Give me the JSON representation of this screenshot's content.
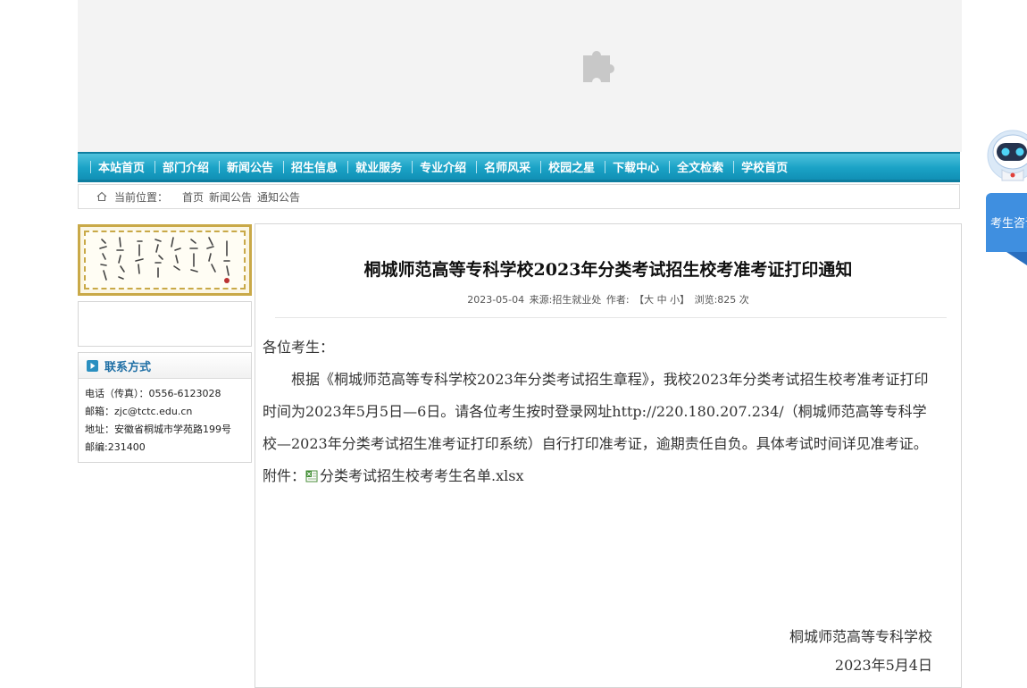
{
  "nav": {
    "items": [
      "本站首页",
      "部门介绍",
      "新闻公告",
      "招生信息",
      "就业服务",
      "专业介绍",
      "名师风采",
      "校园之星",
      "下载中心",
      "全文检索",
      "学校首页"
    ]
  },
  "breadcrumb": {
    "label": "当前位置：",
    "links": [
      "首页",
      "新闻公告",
      "通知公告"
    ]
  },
  "sidebar": {
    "contact_title": "联系方式",
    "contact_lines": [
      "电话（传真）：0556-6123028",
      "邮箱：zjc@tctc.edu.cn",
      "地址：安徽省桐城市学苑路199号",
      "邮编:231400"
    ]
  },
  "article": {
    "title": "桐城师范高等专科学校2023年分类考试招生校考准考证打印通知",
    "date": "2023-05-04",
    "source": "来源:招生就业处",
    "author": "作者:",
    "size_label": "【大 中 小】",
    "views": "浏览:825 次",
    "greeting": "各位考生：",
    "paragraph": "根据《桐城师范高等专科学校2023年分类考试招生章程》，我校2023年分类考试招生校考准考证打印时间为2023年5月5日—6日。请各位考生按时登录网址http://220.180.207.234/（桐城师范高等专科学校—2023年分类考试招生准考证打印系统）自行打印准考证，逾期责任自负。具体考试时间详见准考证。",
    "attachment_label": "附件：",
    "attachment_name": "分类考试招生校考考生名单.xlsx",
    "signature": "桐城师范高等专科学校",
    "sign_date": "2023年5月4日"
  },
  "widget": {
    "label": "考生咨询"
  },
  "colors": {
    "nav": "#1aa2c6",
    "accent": "#1f6fa5",
    "widget": "#3f8fe0"
  }
}
